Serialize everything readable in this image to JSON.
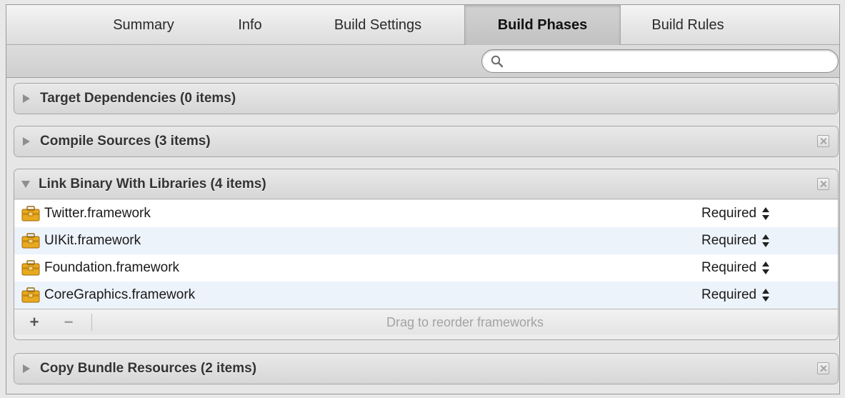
{
  "tabs": [
    {
      "label": "Summary",
      "selected": false
    },
    {
      "label": "Info",
      "selected": false
    },
    {
      "label": "Build Settings",
      "selected": false
    },
    {
      "label": "Build Phases",
      "selected": true
    },
    {
      "label": "Build Rules",
      "selected": false
    }
  ],
  "search": {
    "value": "",
    "placeholder": ""
  },
  "phases": {
    "target_dependencies": {
      "title": "Target Dependencies (0 items)",
      "expanded": false,
      "removable": false
    },
    "compile_sources": {
      "title": "Compile Sources (3 items)",
      "expanded": false,
      "removable": true
    },
    "link_binary": {
      "title": "Link Binary With Libraries (4 items)",
      "expanded": true,
      "removable": true,
      "libraries": [
        {
          "name": "Twitter.framework",
          "status": "Required"
        },
        {
          "name": "UIKit.framework",
          "status": "Required"
        },
        {
          "name": "Foundation.framework",
          "status": "Required"
        },
        {
          "name": "CoreGraphics.framework",
          "status": "Required"
        }
      ],
      "footer": {
        "add_label": "+",
        "remove_label": "−",
        "hint": "Drag to reorder frameworks"
      }
    },
    "copy_bundle_resources": {
      "title": "Copy Bundle Resources (2 items)",
      "expanded": false,
      "removable": true
    }
  },
  "colors": {
    "accent_row": "#edf3fb",
    "framework_icon": "#e9a91e"
  }
}
